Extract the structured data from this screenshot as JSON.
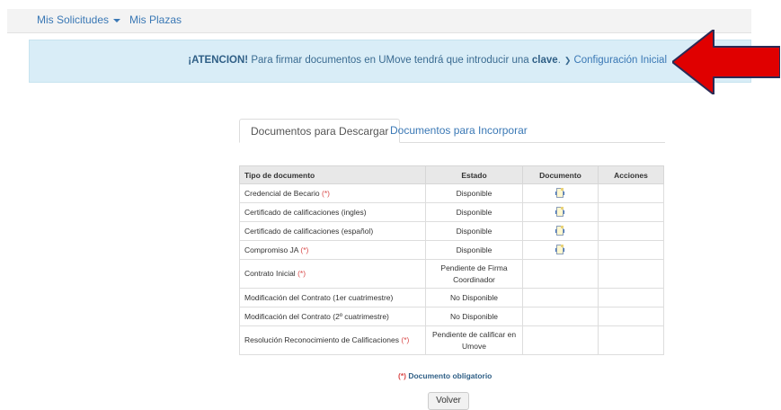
{
  "nav": {
    "solicitudes_label": "Mis Solicitudes",
    "plazas_label": "Mis Plazas"
  },
  "alert": {
    "strong_prefix": "¡ATENCION!",
    "text": " Para firmar documentos en UMove tendrá que introducir una ",
    "keyword": "clave",
    "period": ".",
    "link_label": "Configuración Inicial"
  },
  "tabs": [
    {
      "label": "Documentos para Descargar",
      "active": true
    },
    {
      "label": "Documentos para Incorporar",
      "active": false
    }
  ],
  "table": {
    "headers": [
      "Tipo de documento",
      "Estado",
      "Documento",
      "Acciones"
    ],
    "rows": [
      {
        "tipo": "Credencial de Becario",
        "required": "(*)",
        "estado": "Disponible",
        "has_doc": true
      },
      {
        "tipo": "Certificado de calificaciones (ingles)",
        "required": "",
        "estado": "Disponible",
        "has_doc": true
      },
      {
        "tipo": "Certificado de calificaciones (español)",
        "required": "",
        "estado": "Disponible",
        "has_doc": true
      },
      {
        "tipo": "Compromiso JA",
        "required": "(*)",
        "estado": "Disponible",
        "has_doc": true
      },
      {
        "tipo": "Contrato Inicial",
        "required": "(*)",
        "estado": "Pendiente de Firma Coordinador",
        "has_doc": false
      },
      {
        "tipo": "Modificación del Contrato (1er cuatrimestre)",
        "required": "",
        "estado": "No Disponible",
        "has_doc": false
      },
      {
        "tipo": "Modificación del Contrato (2º cuatrimestre)",
        "required": "",
        "estado": "No Disponible",
        "has_doc": false
      },
      {
        "tipo": "Resolución Reconocimiento de Calificaciones",
        "required": "(*)",
        "estado": "Pendiente de calificar en Umove",
        "has_doc": false
      }
    ]
  },
  "note": {
    "marker": "(*)",
    "text": " Documento obligatorio"
  },
  "back_label": "Volver",
  "icons": {
    "dropdown": "caret-down-icon",
    "alert_link": "chevron-down-icon",
    "document": "document-icon"
  },
  "colors": {
    "link": "#3a78b5",
    "alert_bg": "#d9edf7",
    "required": "#d94b4b",
    "arrow": "#e00000"
  }
}
